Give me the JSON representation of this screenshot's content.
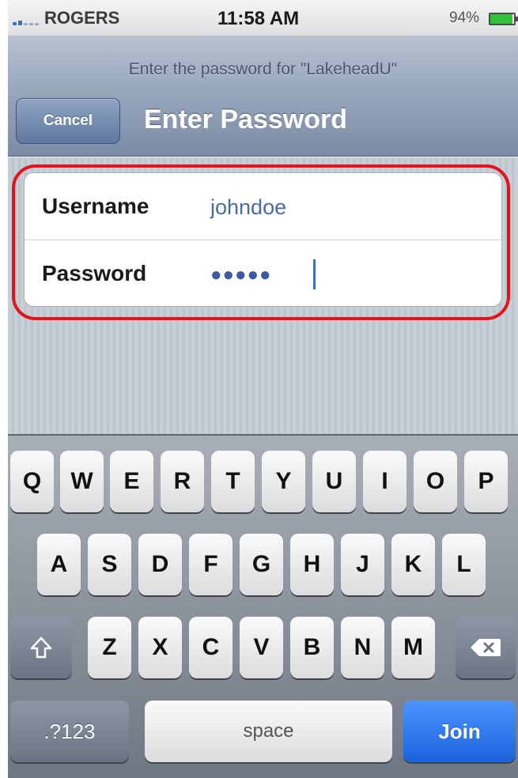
{
  "status_bar": {
    "carrier": "ROGERS",
    "time": "11:58 AM",
    "battery_percent": "94%",
    "battery_level": 0.94
  },
  "nav": {
    "prompt": "Enter the password for \"LakeheadU\"",
    "title": "Enter Password",
    "cancel_label": "Cancel"
  },
  "form": {
    "username_label": "Username",
    "username_value": "johndoe",
    "password_label": "Password",
    "password_masked": "●●●●●"
  },
  "keyboard": {
    "row1": [
      "Q",
      "W",
      "E",
      "R",
      "T",
      "Y",
      "U",
      "I",
      "O",
      "P"
    ],
    "row2": [
      "A",
      "S",
      "D",
      "F",
      "G",
      "H",
      "J",
      "K",
      "L"
    ],
    "row3": [
      "Z",
      "X",
      "C",
      "V",
      "B",
      "N",
      "M"
    ],
    "numbers_label": ".?123",
    "space_label": "space",
    "join_label": "Join",
    "shift_icon": "shift-arrow",
    "delete_icon": "backspace-x"
  },
  "colors": {
    "highlight": "#e2141b",
    "join_key": "#1a63dc",
    "input_text": "#4a6aa5"
  }
}
